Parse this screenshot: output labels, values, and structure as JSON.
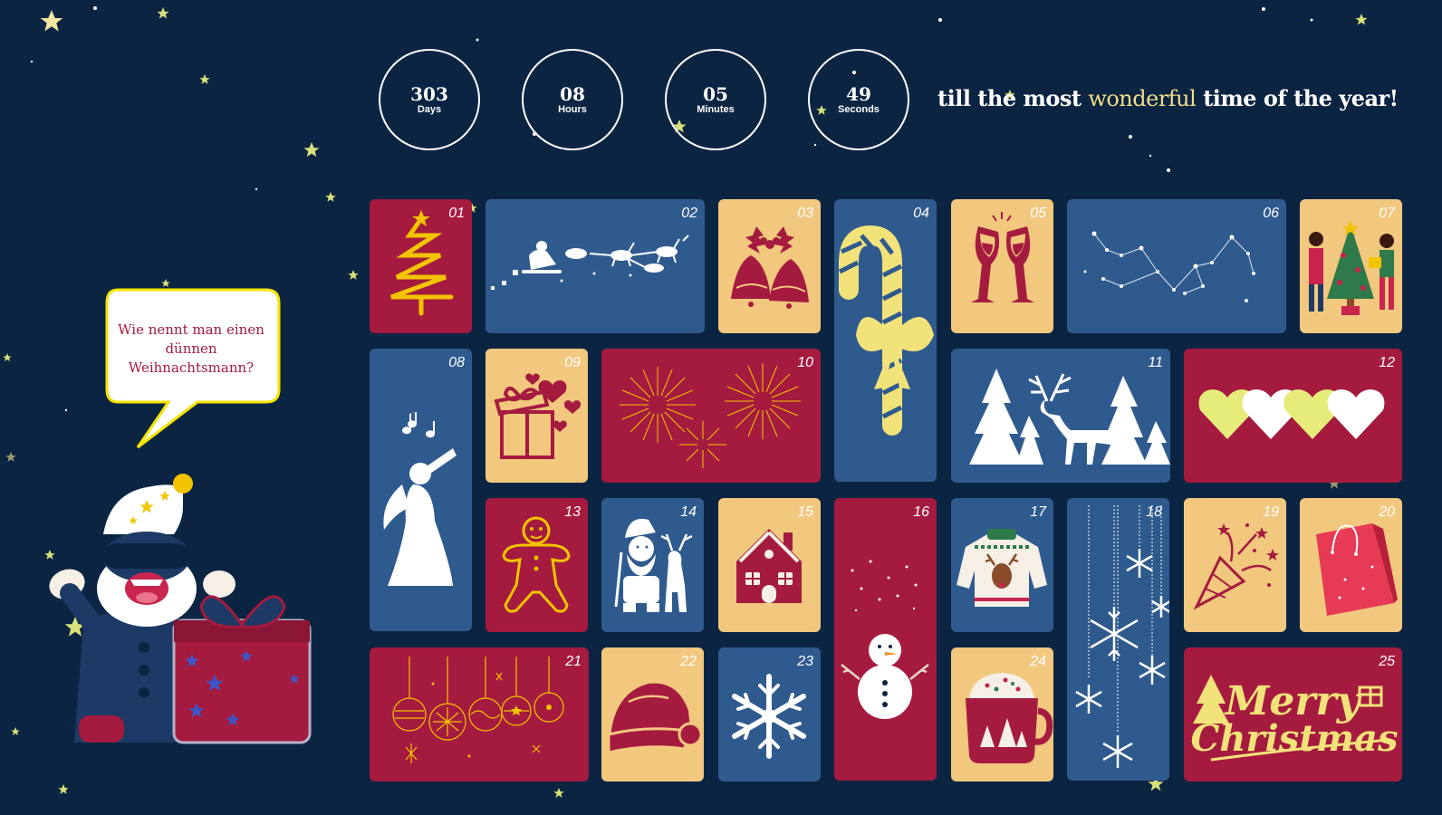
{
  "countdown": {
    "days": {
      "value": "303",
      "label": "Days"
    },
    "hours": {
      "value": "08",
      "label": "Hours"
    },
    "minutes": {
      "value": "05",
      "label": "Minutes"
    },
    "seconds": {
      "value": "49",
      "label": "Seconds"
    }
  },
  "tagline": {
    "before": "till the most",
    "highlight": "wonderful",
    "after": "time of the year!"
  },
  "speech_bubble": {
    "text": "Wie nennt man einen dünnen Weihnachtsmann?"
  },
  "doors": [
    {
      "number": "01",
      "icon": "christmas-tree-icon"
    },
    {
      "number": "02",
      "icon": "santa-sleigh-icon"
    },
    {
      "number": "03",
      "icon": "bells-icon"
    },
    {
      "number": "04",
      "icon": "candy-cane-icon"
    },
    {
      "number": "05",
      "icon": "wine-glasses-icon"
    },
    {
      "number": "06",
      "icon": "constellation-icon"
    },
    {
      "number": "07",
      "icon": "people-tree-icon"
    },
    {
      "number": "08",
      "icon": "angel-trumpet-icon"
    },
    {
      "number": "09",
      "icon": "gift-hearts-icon"
    },
    {
      "number": "10",
      "icon": "fireworks-icon"
    },
    {
      "number": "11",
      "icon": "reindeer-forest-icon"
    },
    {
      "number": "12",
      "icon": "hearts-icon"
    },
    {
      "number": "13",
      "icon": "gingerbread-man-icon"
    },
    {
      "number": "14",
      "icon": "santa-reindeer-icon"
    },
    {
      "number": "15",
      "icon": "gingerbread-house-icon"
    },
    {
      "number": "16",
      "icon": "snowman-icon"
    },
    {
      "number": "17",
      "icon": "ugly-sweater-icon"
    },
    {
      "number": "18",
      "icon": "hanging-snowflakes-icon"
    },
    {
      "number": "19",
      "icon": "party-popper-icon"
    },
    {
      "number": "20",
      "icon": "shopping-bag-icon"
    },
    {
      "number": "21",
      "icon": "ornaments-icon"
    },
    {
      "number": "22",
      "icon": "santa-hat-icon"
    },
    {
      "number": "23",
      "icon": "snowflake-icon"
    },
    {
      "number": "24",
      "icon": "cocoa-mug-icon"
    },
    {
      "number": "25",
      "icon": "merry-christmas-icon"
    }
  ],
  "merry_christmas": {
    "line1": "Merry",
    "line2": "Christmas"
  },
  "colors": {
    "background": "#0b2442",
    "red": "#a51b3f",
    "blue": "#2f5a8e",
    "yellow": "#f2c77e",
    "accent": "#f3dd8a"
  }
}
